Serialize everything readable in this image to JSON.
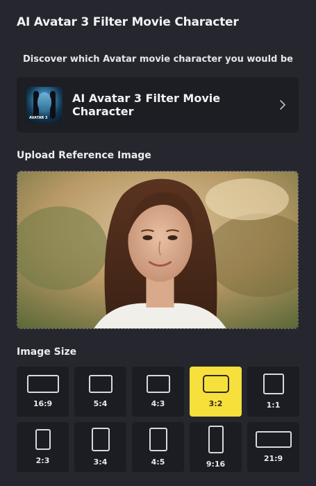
{
  "header": {
    "title": "AI Avatar 3 Filter Movie Character"
  },
  "subtitle": "Discover which Avatar movie character you would be",
  "model_card": {
    "name": "AI Avatar 3 Filter Movie Character",
    "thumb_tag": "AVATAR 3"
  },
  "upload": {
    "label": "Upload Reference Image"
  },
  "image_size": {
    "label": "Image Size",
    "selected": "3:2",
    "options": [
      "16:9",
      "5:4",
      "4:3",
      "3:2",
      "1:1",
      "2:3",
      "3:4",
      "4:5",
      "9:16",
      "21:9"
    ]
  },
  "colors": {
    "accent": "#f7df3c",
    "background": "#26272e",
    "card": "#1d1e24"
  }
}
